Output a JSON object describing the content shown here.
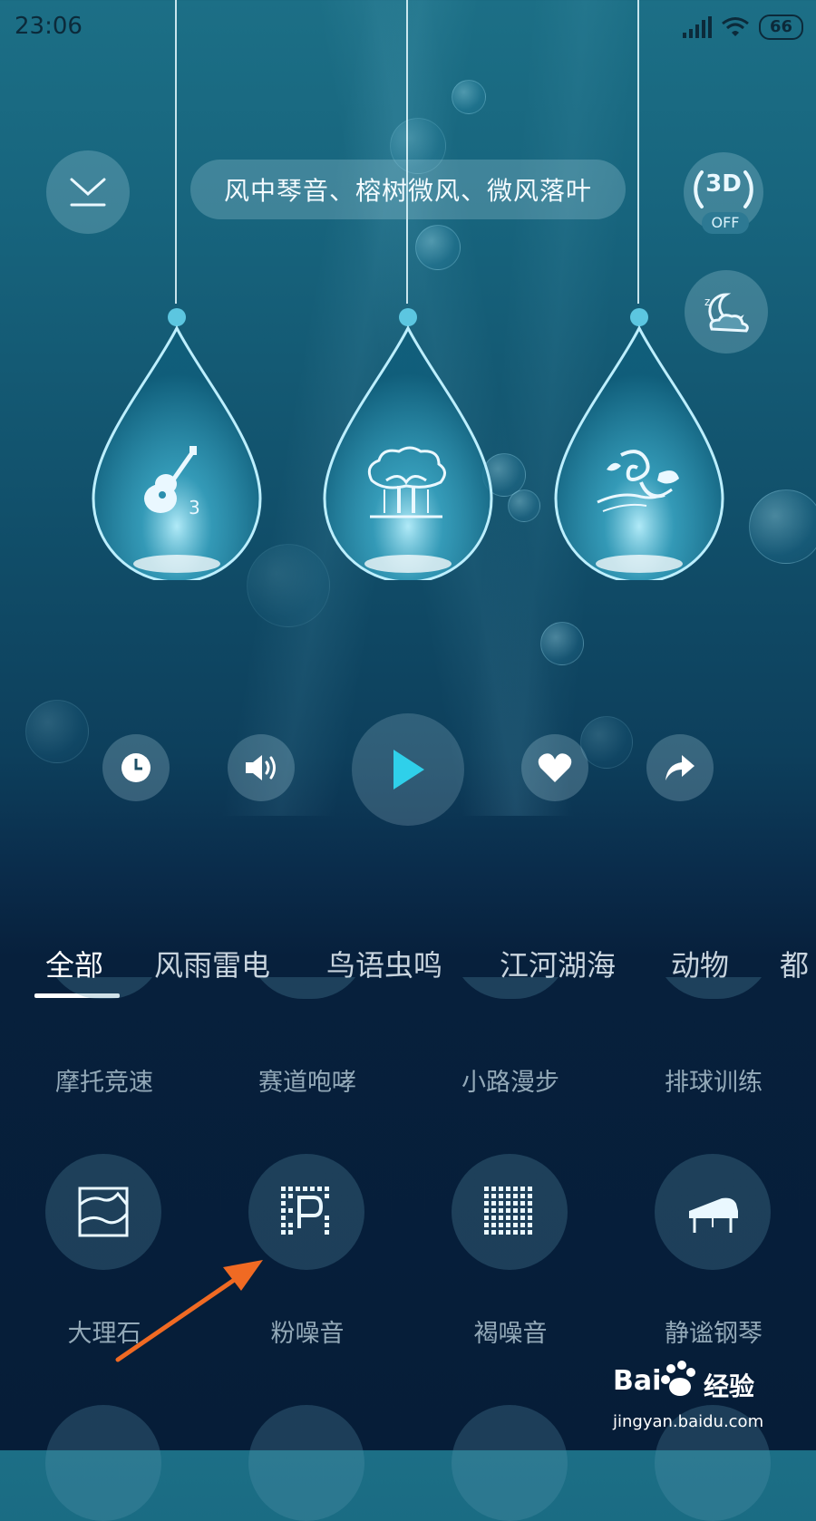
{
  "status_bar": {
    "time": "23:06",
    "battery": "66",
    "icons": [
      "signal-icon",
      "wifi-icon",
      "battery-icon"
    ]
  },
  "header": {
    "collapse_icon": "download-arrow-icon",
    "title": "风中琴音、榕树微风、微风落叶",
    "badge_3d": {
      "label": "3D",
      "state": "OFF"
    },
    "sleep_icon": "moon-cloud-icon"
  },
  "drops": [
    {
      "icon": "guitar-icon",
      "count": "3"
    },
    {
      "icon": "banyan-tree-icon"
    },
    {
      "icon": "wind-leaf-icon"
    }
  ],
  "controls": {
    "icons": [
      "timer-icon",
      "volume-icon",
      "play-icon",
      "favorite-icon",
      "share-icon"
    ]
  },
  "tabs": {
    "items": [
      "全部",
      "风雨雷电",
      "鸟语虫鸣",
      "江河湖海",
      "动物",
      "都"
    ],
    "active": "全部"
  },
  "grid": {
    "row_partial_labels": [
      "摩托竞速",
      "赛道咆哮",
      "小路漫步",
      "排球训练"
    ],
    "row_full": [
      {
        "label": "大理石",
        "icon": "marble-icon"
      },
      {
        "label": "粉噪音",
        "icon": "pink-noise-icon"
      },
      {
        "label": "褐噪音",
        "icon": "brown-noise-icon"
      },
      {
        "label": "静谧钢琴",
        "icon": "piano-icon"
      }
    ]
  },
  "colors": {
    "play_accent": "#2fd0ea",
    "arrow": "#f06a23"
  },
  "watermark": {
    "brand_left": "Bai",
    "brand_right": "经验",
    "url": "jingyan.baidu.com"
  }
}
